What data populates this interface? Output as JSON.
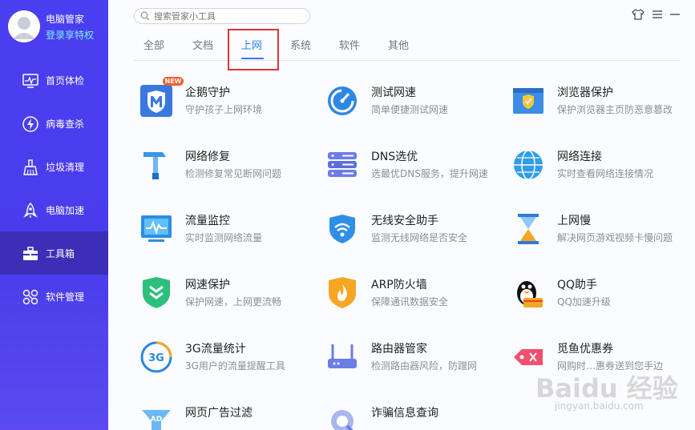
{
  "user": {
    "name": "电脑管家",
    "vip_link": "登录享特权"
  },
  "sidebar": {
    "items": [
      {
        "label": "首页体检",
        "icon": "monitor-icon"
      },
      {
        "label": "病毒查杀",
        "icon": "lightning-icon"
      },
      {
        "label": "垃圾清理",
        "icon": "broom-icon"
      },
      {
        "label": "电脑加速",
        "icon": "rocket-icon"
      },
      {
        "label": "工具箱",
        "icon": "toolbox-icon",
        "active": true
      },
      {
        "label": "软件管理",
        "icon": "apps-icon"
      }
    ]
  },
  "search": {
    "placeholder": "搜索管家小工具"
  },
  "tabs": [
    {
      "label": "全部"
    },
    {
      "label": "文档"
    },
    {
      "label": "上网",
      "active": true
    },
    {
      "label": "系统"
    },
    {
      "label": "软件"
    },
    {
      "label": "其他"
    }
  ],
  "badge": {
    "new": "NEW"
  },
  "tools": [
    {
      "title": "企鹅守护",
      "desc": "守护孩子上网环境",
      "icon": "penguin-shield-icon"
    },
    {
      "title": "测试网速",
      "desc": "简单便捷测试网速",
      "icon": "speedometer-icon"
    },
    {
      "title": "浏览器保护",
      "desc": "保护浏览器主页防恶意篡改",
      "icon": "browser-shield-icon"
    },
    {
      "title": "网络修复",
      "desc": "检测修复常见断网问题",
      "icon": "hammer-icon"
    },
    {
      "title": "DNS选优",
      "desc": "选最优DNS服务，提升网速",
      "icon": "server-icon"
    },
    {
      "title": "网络连接",
      "desc": "实时查看网络连接情况",
      "icon": "globe-icon"
    },
    {
      "title": "流量监控",
      "desc": "实时监测网络流量",
      "icon": "traffic-monitor-icon"
    },
    {
      "title": "无线安全助手",
      "desc": "监测无线网络是否安全",
      "icon": "wifi-shield-icon"
    },
    {
      "title": "上网慢",
      "desc": "解决网页游戏视频卡慢问题",
      "icon": "hourglass-icon"
    },
    {
      "title": "网速保护",
      "desc": "保护网速，上网更流畅",
      "icon": "speed-shield-icon"
    },
    {
      "title": "ARP防火墙",
      "desc": "保障通讯数据安全",
      "icon": "firewall-icon"
    },
    {
      "title": "QQ助手",
      "desc": "QQ加速升级",
      "icon": "qq-icon"
    },
    {
      "title": "3G流量统计",
      "desc": "3G用户的流量提醒工具",
      "icon": "3g-icon"
    },
    {
      "title": "路由器管家",
      "desc": "检测路由器风险，防蹭网",
      "icon": "router-icon"
    },
    {
      "title": "觅鱼优惠券",
      "desc": "网购时…惠券送到您手边",
      "icon": "coupon-fish-icon"
    },
    {
      "title": "网页广告过滤",
      "desc": "",
      "icon": "ad-filter-icon"
    },
    {
      "title": "诈骗信息查询",
      "desc": "",
      "icon": "fraud-check-icon"
    }
  ],
  "watermark": {
    "main": "Baidu 经验",
    "sub": "jingyan.baidu.com"
  },
  "colors": {
    "sidebar": "#4a3ff0",
    "active_tab": "#2e7df6",
    "highlight": "#d8363b"
  }
}
